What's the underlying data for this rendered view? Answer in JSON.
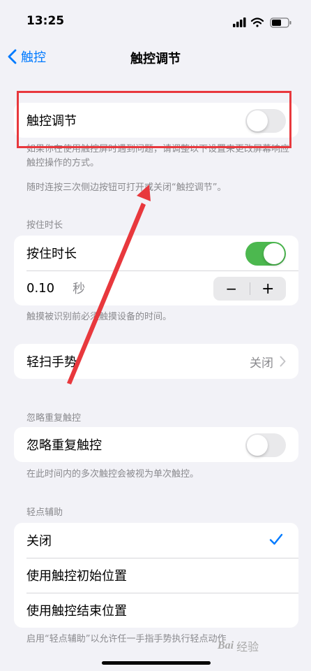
{
  "status_bar": {
    "time": "13:25"
  },
  "nav": {
    "back_label": "触控",
    "title": "触控调节"
  },
  "touch_accommodations": {
    "label": "触控调节",
    "toggle_on": false,
    "footer_line1": "如果你在使用触控屏时遇到问题，请调整以下设置来更改屏幕响应触控操作的方式。",
    "footer_line2": "随时连按三次侧边按钮可打开或关闭“触控调节”。"
  },
  "hold_duration": {
    "header": "按住时长",
    "label": "按住时长",
    "toggle_on": true,
    "value": "0.10",
    "unit": "秒",
    "minus": "−",
    "plus": "+",
    "footer": "触摸被识别前必须触摸设备的时间。"
  },
  "swipe_gestures": {
    "label": "轻扫手势",
    "value": "关闭"
  },
  "ignore_repeat": {
    "header": "忽略重复触控",
    "label": "忽略重复触控",
    "toggle_on": false,
    "footer": "在此时间内的多次触控会被视为单次触控。"
  },
  "tap_assistance": {
    "header": "轻点辅助",
    "options": [
      {
        "label": "关闭",
        "selected": true
      },
      {
        "label": "使用触控初始位置",
        "selected": false
      },
      {
        "label": "使用触控结束位置",
        "selected": false
      }
    ],
    "footer": "启用“轻点辅助”以允许任一手指手势执行轻点动作"
  },
  "watermark": {
    "logo": "Bai",
    "text": "经验"
  },
  "colors": {
    "accent": "#007aff",
    "toggle_on": "#4cb84f",
    "annotation": "#e8383d"
  }
}
